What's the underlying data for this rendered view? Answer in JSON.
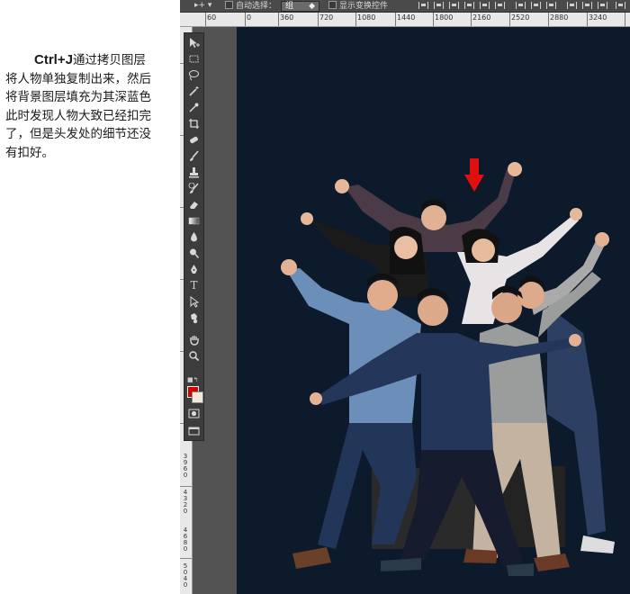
{
  "instructions": {
    "shortcut": "Ctrl+J",
    "line1_rest": "通过拷贝图层",
    "line2": "将人物单独复制出来，然后",
    "line3": "将背景图层填充为其深蓝色",
    "line4": "此时发现人物大致已经扣完",
    "line5": "了，但是头发处的细节还没",
    "line6": "有扣好。"
  },
  "options_bar": {
    "auto_select_label": "自动选择：",
    "auto_select_value": "组",
    "show_transform_label": "显示变换控件"
  },
  "ruler": {
    "top_labels": [
      "60",
      "0",
      "360",
      "720",
      "1080",
      "1440",
      "1800",
      "2160",
      "2520",
      "2880",
      "3240"
    ],
    "left_labels": [
      "3960",
      "4320",
      "4680",
      "5040"
    ]
  },
  "colors": {
    "foreground": "#d40000",
    "background": "#f4e8d8",
    "canvas": "#0c1a2c",
    "arrow": "#e01010"
  },
  "tools": [
    "move-icon",
    "marquee-icon",
    "lasso-icon",
    "magic-wand-icon",
    "eyedropper-icon",
    "crop-icon",
    "healing-brush-icon",
    "brush-icon",
    "stamp-icon",
    "history-brush-icon",
    "eraser-icon",
    "gradient-icon",
    "blur-icon",
    "dodge-icon",
    "pen-icon",
    "type-icon",
    "path-select-icon",
    "shape-icon",
    "hand-icon",
    "zoom-icon"
  ]
}
